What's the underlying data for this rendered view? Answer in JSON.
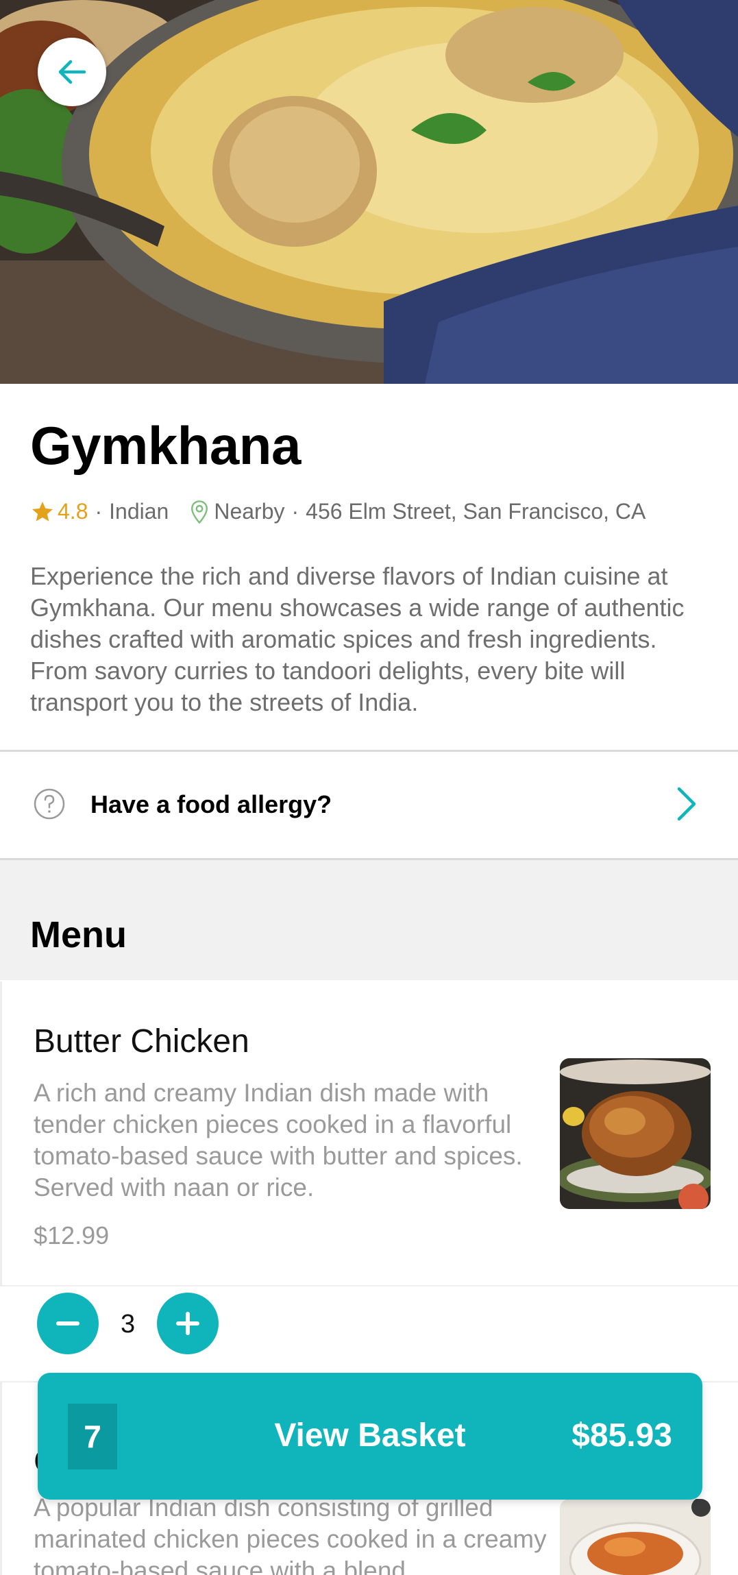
{
  "restaurant": {
    "name": "Gymkhana",
    "rating": "4.8",
    "cuisine": "Indian",
    "distance": "Nearby",
    "address": "456 Elm Street, San Francisco, CA",
    "description": "Experience the rich and diverse flavors of Indian cuisine at Gymkhana. Our menu showcases a wide range of authentic dishes crafted with aromatic spices and fresh ingredients. From savory curries to tandoori delights, every bite will transport you to the streets of India."
  },
  "allergy": {
    "label": "Have a food allergy?"
  },
  "menu": {
    "title": "Menu",
    "items": [
      {
        "name": "Butter Chicken",
        "description": "A rich and creamy Indian dish made with tender chicken pieces cooked in a flavorful tomato-based sauce with butter and spices. Served with naan or rice.",
        "price": "$12.99",
        "quantity": "3"
      },
      {
        "name": "C",
        "description": "A popular Indian dish consisting of grilled marinated chicken pieces cooked in a creamy tomato-based sauce with a blend"
      }
    ]
  },
  "basket": {
    "count": "7",
    "label": "View Basket",
    "total": "$85.93"
  },
  "colors": {
    "accent": "#10b4bb",
    "star": "#e3a21a",
    "pin": "#7dbf7a"
  },
  "icons": {
    "back": "arrow-left-icon",
    "star": "star-icon",
    "pin": "location-pin-icon",
    "help": "question-circle-icon",
    "chevron": "chevron-right-icon",
    "minus": "minus-icon",
    "plus": "plus-icon"
  }
}
